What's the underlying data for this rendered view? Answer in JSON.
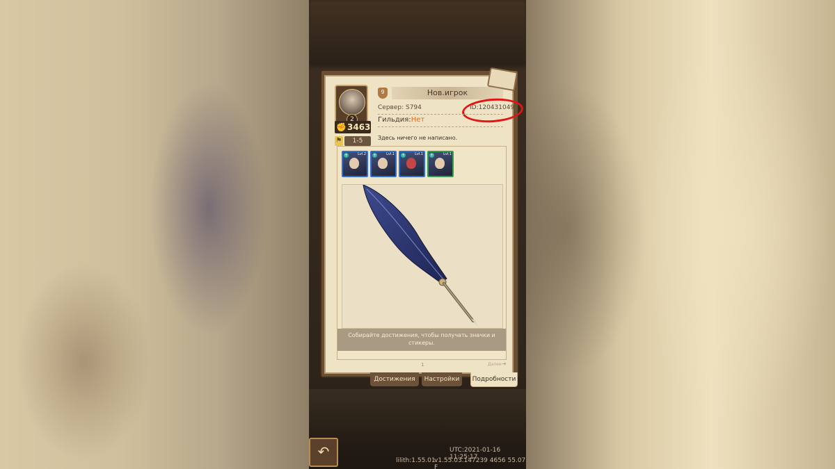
{
  "profile": {
    "name": "Нов.игрок",
    "rank_number": "9",
    "server": "Сервер: S794",
    "player_id": "ID:120431049",
    "guild_label": "Гильдия:",
    "guild_value": "Нет",
    "motto": "Здесь ничего не написано.",
    "avatar_level": "2",
    "power": "3463",
    "stage": "1-5"
  },
  "team": [
    {
      "level": "Lvl.2",
      "frame": "blue"
    },
    {
      "level": "Lvl.1",
      "frame": "blue"
    },
    {
      "level": "Lvl.1",
      "frame": "blue"
    },
    {
      "level": "Lvl.1",
      "frame": "green"
    }
  ],
  "achievements": {
    "caption": "Собирайте достижения, чтобы получать значки и стикеры.",
    "page": "1",
    "next_label": "Далее"
  },
  "tabs": {
    "achievements": "Достижения",
    "settings": "Настройки",
    "details": "Подробности"
  },
  "footer": {
    "utc": "UTC:2021-01-16 11:25:17",
    "lilith_version": "lilith:1.55.01",
    "client_version": "v1.55.03.147239 4656 55.07 F"
  },
  "icons": {
    "back": "back-arrow-icon",
    "power": "fist-icon",
    "stage": "stage-flag-icon",
    "rank": "rank-shield-icon"
  },
  "colors": {
    "guild_value": "#e06a1f",
    "highlight_circle": "#e31414",
    "hero_frame_blue": "#2f6fd3",
    "hero_frame_green": "#2f9d4c"
  }
}
